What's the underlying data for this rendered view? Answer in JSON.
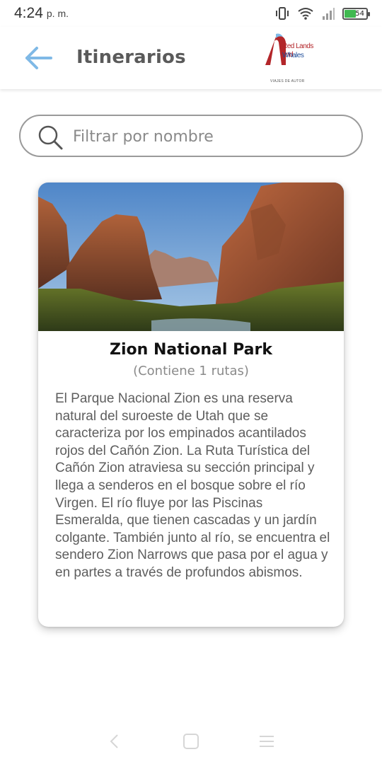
{
  "status_bar": {
    "time": "4:24",
    "ampm": "p. m.",
    "battery": "54"
  },
  "app_bar": {
    "title": "Itinerarios",
    "logo": {
      "line1": "Red Lands and",
      "line2": "Whales",
      "tagline": "VIAJES DE AUTOR"
    }
  },
  "search": {
    "placeholder": "Filtrar por nombre",
    "value": ""
  },
  "itineraries": [
    {
      "name": "Zion National Park",
      "routes_text": "(Contiene 1 rutas)",
      "description": "El Parque Nacional Zion es una reserva natural del suroeste de Utah que se caracteriza por los empinados acantilados rojos del Cañón Zion. La Ruta Turística del Cañón Zion atraviesa su sección principal y llega a senderos en el bosque sobre el río Virgen. El río fluye por las Piscinas Esmeralda, que tienen cascadas y un jardín colgante. También junto al río, se encuentra el sendero Zion Narrows que pasa por el agua y en partes a través de profundos abismos."
    }
  ],
  "colors": {
    "accent": "#7fb9e6",
    "title": "#5a5a5a",
    "search_border": "#9a9a9a",
    "battery": "#3fb950"
  },
  "icons": [
    "back-arrow-icon",
    "search-icon",
    "vibrate-icon",
    "wifi-icon",
    "signal-icon",
    "battery-icon",
    "nav-back-icon",
    "nav-home-icon",
    "nav-menu-icon"
  ]
}
